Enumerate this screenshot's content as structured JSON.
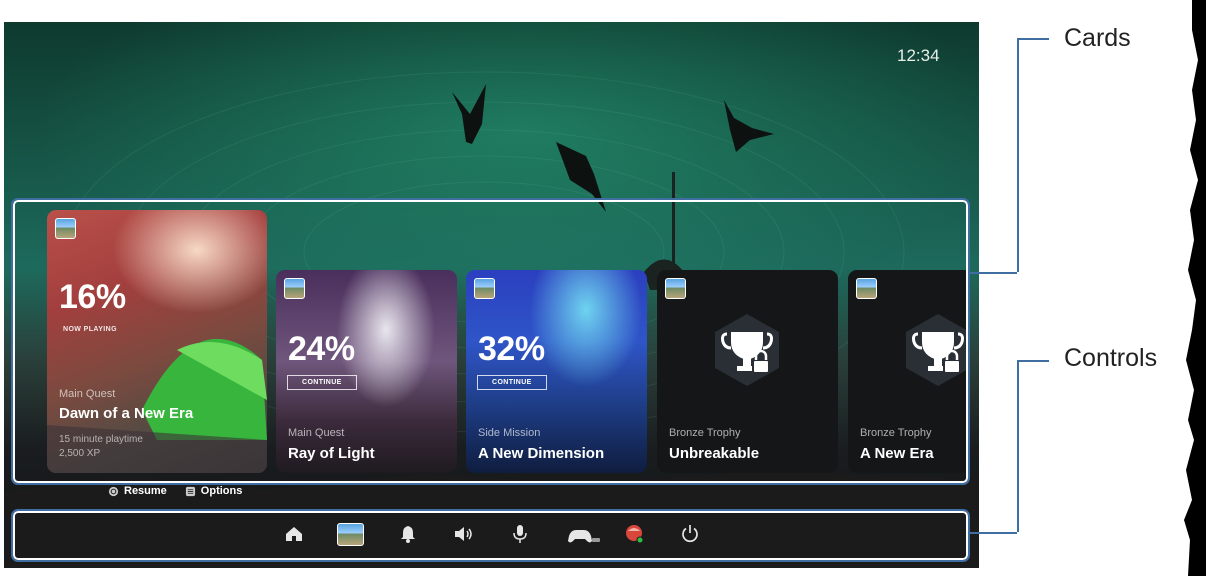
{
  "clock": "12:34",
  "cards": [
    {
      "percent": "16%",
      "status": "NOW PLAYING",
      "category": "Main Quest",
      "title": "Dawn of a New Era",
      "playtime": "15 minute playtime",
      "xp": "2,500 XP"
    },
    {
      "percent": "24%",
      "button": "CONTINUE",
      "category": "Main Quest",
      "title": "Ray of Light"
    },
    {
      "percent": "32%",
      "button": "CONTINUE",
      "category": "Side Mission",
      "title": "A New Dimension"
    },
    {
      "category": "Bronze Trophy",
      "title": "Unbreakable",
      "icon": "trophy-lock-icon"
    },
    {
      "category": "Bronze Trophy",
      "title": "A New Era",
      "icon": "trophy-lock-icon"
    }
  ],
  "hints": {
    "resume": "Resume",
    "options": "Options"
  },
  "controls": [
    "home-icon",
    "game-icon",
    "bell-icon",
    "volume-icon",
    "mic-icon",
    "controller-icon",
    "avatar-icon",
    "power-icon"
  ],
  "callouts": {
    "cards": "Cards",
    "controls": "Controls"
  },
  "colors": {
    "frame": "#3f6ea3",
    "accent_green": "#1d6a5c"
  }
}
